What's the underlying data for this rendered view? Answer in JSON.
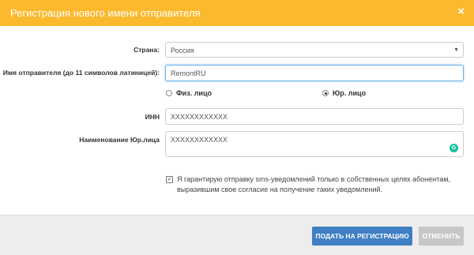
{
  "dialog": {
    "title": "Регистрация нового имени отправителя",
    "close_icon": "×"
  },
  "form": {
    "country": {
      "label": "Страна:",
      "value": "Россия",
      "arrow": "▼"
    },
    "sender_name": {
      "label": "Имя отправителя (до 11 символов латиницей):",
      "value": "RemontRU"
    },
    "person_type": {
      "options": [
        {
          "label": "Физ. лицо",
          "checked": false
        },
        {
          "label": "Юр. лицо",
          "checked": true
        }
      ]
    },
    "inn": {
      "label": "ИНН",
      "value": "XXXXXXXXXXXX"
    },
    "company_name": {
      "label": "Наименование Юр.лица",
      "value": "XXXXXXXXXXXX",
      "grammarly_icon": "G"
    },
    "agreement": {
      "checked": true,
      "check_mark": "✓",
      "text": "Я гарантирую отправку sms-уведомлений только в собственных целях абонентам, выразившим свое согласие на получение таких уведомлений."
    }
  },
  "footer": {
    "submit_label": "ПОДАТЬ НА РЕГИСТРАЦИЮ",
    "cancel_label": "ОТМЕНИТЬ"
  },
  "colors": {
    "header": "#fbb92e",
    "primary_button": "#3f7fc4",
    "cancel_button": "#c7c7c7",
    "grammarly": "#15c39a"
  }
}
